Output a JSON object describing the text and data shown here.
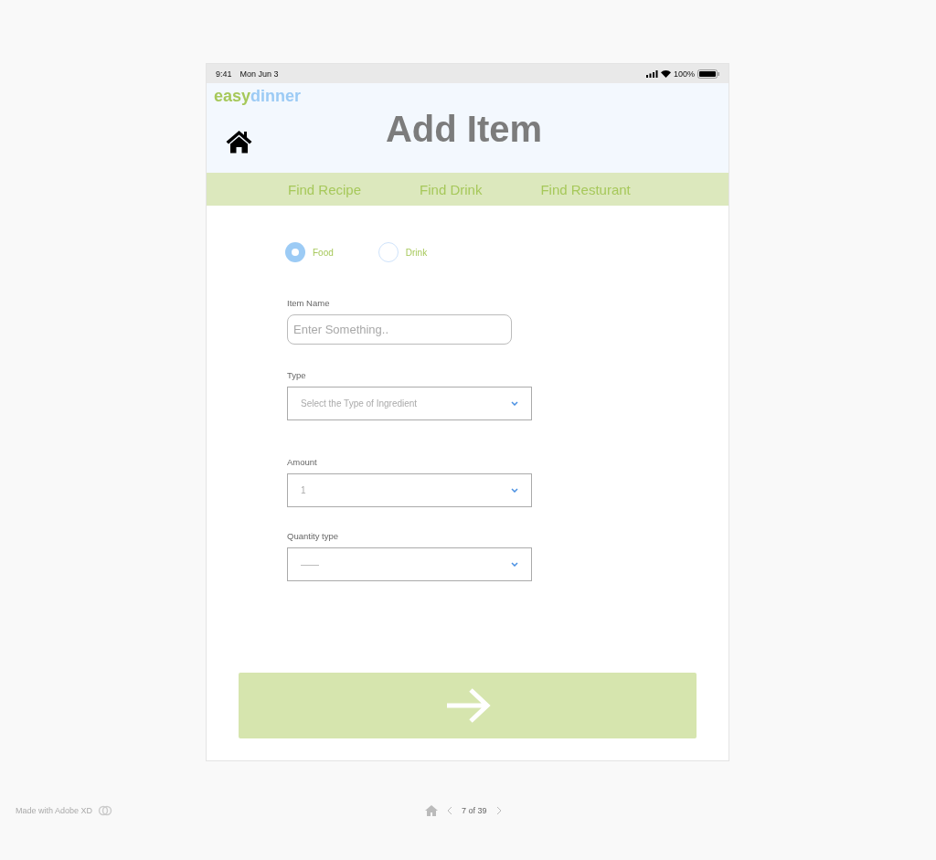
{
  "status_bar": {
    "time": "9:41",
    "date": "Mon Jun 3",
    "battery": "100%"
  },
  "header": {
    "logo": [
      "easy",
      "dinner"
    ],
    "title": "Add Item"
  },
  "nav": [
    {
      "label": "Find Recipe"
    },
    {
      "label": "Find Drink"
    },
    {
      "label": "Find Resturant"
    }
  ],
  "category": [
    {
      "label": "Food",
      "selected": true
    },
    {
      "label": "Drink",
      "selected": false
    }
  ],
  "fields": [
    {
      "kind": "input",
      "label": "Item Name",
      "placeholder": "Enter Something.."
    },
    {
      "kind": "select",
      "label": "Type",
      "placeholder": "Select the Type of Ingredient"
    },
    {
      "kind": "select",
      "label": "Amount",
      "value": "1"
    },
    {
      "kind": "select",
      "label": "Quantity type",
      "value": "——"
    }
  ],
  "footer": {
    "credit": "Made with Adobe XD",
    "page": "7 of 39"
  }
}
